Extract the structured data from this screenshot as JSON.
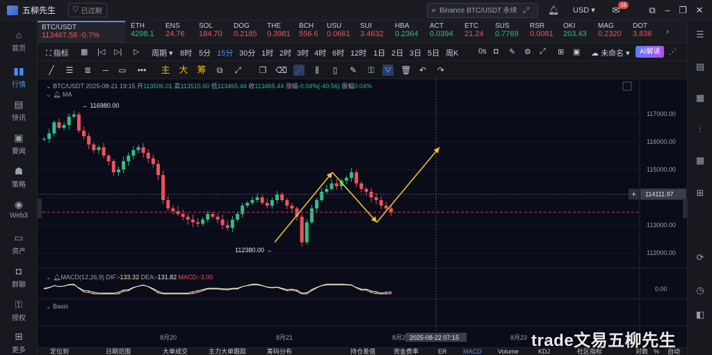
{
  "app": {
    "title": "五柳先生",
    "expired_label": "已过期"
  },
  "search": {
    "placeholder": "Binance BTC/USDT 永续"
  },
  "header": {
    "currency": "USD",
    "message_count": "16"
  },
  "sidebar": {
    "items": [
      {
        "label": "首页",
        "icon": "home-icon"
      },
      {
        "label": "行情",
        "icon": "market-chart-icon"
      },
      {
        "label": "快讯",
        "icon": "news-flash-icon"
      },
      {
        "label": "要闻",
        "icon": "headline-icon"
      },
      {
        "label": "策略",
        "icon": "strategy-icon"
      },
      {
        "label": "Web3",
        "icon": "web3-icon"
      },
      {
        "label": "资产",
        "icon": "wallet-icon"
      },
      {
        "label": "群聊",
        "icon": "group-chat-icon"
      },
      {
        "label": "授权",
        "icon": "authorize-icon"
      },
      {
        "label": "更多",
        "icon": "more-icon"
      }
    ]
  },
  "tickers": [
    {
      "name": "BTC/USDT",
      "price": "113467.58",
      "change": "-0.7%",
      "dir": "down"
    },
    {
      "name": "ETH",
      "price": "4298.1",
      "dir": "up"
    },
    {
      "name": "ENS",
      "price": "24.76",
      "dir": "down"
    },
    {
      "name": "SOL",
      "price": "184.70",
      "dir": "down"
    },
    {
      "name": "DOG",
      "price": "0.2185",
      "dir": "down"
    },
    {
      "name": "THE",
      "price": "0.3981",
      "dir": "down"
    },
    {
      "name": "BCH",
      "price": "556.6",
      "dir": "down"
    },
    {
      "name": "USU",
      "price": "0.0661",
      "dir": "down"
    },
    {
      "name": "SUI",
      "price": "3.4632",
      "dir": "down"
    },
    {
      "name": "HBA",
      "price": "0.2364",
      "dir": "up"
    },
    {
      "name": "ACT",
      "price": "0.0394",
      "dir": "up"
    },
    {
      "name": "ETC",
      "price": "21.24",
      "dir": "down"
    },
    {
      "name": "SUS",
      "price": "0.7769",
      "dir": "up"
    },
    {
      "name": "RSR",
      "price": "0.0081",
      "dir": "down"
    },
    {
      "name": "OKI",
      "price": "203.43",
      "dir": "up"
    },
    {
      "name": "MAG",
      "price": "0.2320",
      "dir": "down"
    },
    {
      "name": "DOT",
      "price": "3.836",
      "dir": "down"
    }
  ],
  "toolbar1": {
    "indicator": "指标",
    "period": "周期",
    "timeframes": [
      "8时",
      "5分",
      "15分",
      "30分",
      "1时",
      "2时",
      "3时",
      "4时",
      "6时",
      "12时",
      "1日",
      "2日",
      "3日",
      "5日",
      "周K"
    ],
    "selected_timeframe": "15分",
    "countdown": "0s",
    "unnamed": "未命名",
    "ai_label": "AI解读"
  },
  "toolbar2": {
    "main": "主",
    "large": "大",
    "chips": "筹"
  },
  "chart": {
    "info": {
      "pair": "BTC/USDT",
      "datetime": "2025-08-21 19:15",
      "open_label": "开",
      "open": "113506.01",
      "high_label": "高",
      "high": "113515.60",
      "low_label": "低",
      "low": "113465.44",
      "close_label": "收",
      "close": "113465.44",
      "change_label": "涨幅",
      "change": "-0.04%(-40.56)",
      "amp_label": "振幅",
      "amp": "0.04%"
    },
    "ma_label": "MA",
    "macd_label": "MACD(12,26,9)",
    "dif_label": "DIF:",
    "dif": "-133.32",
    "dea_label": "DEA:",
    "dea": "-131.82",
    "macd_val_label": "MACD:",
    "macd_val": "-3.00",
    "basis_label": "Basis",
    "crosshair_price": "114111.97",
    "crosshair_time": "2025-08-22 07:15",
    "annotations": {
      "high": "116980.00",
      "low": "112380.00"
    }
  },
  "chart_data": {
    "type": "line",
    "title": "BTC/USDT",
    "y_ticks": [
      117000,
      116000,
      115000,
      114000,
      113000,
      112000
    ],
    "ylim": [
      111500,
      117500
    ],
    "x_ticks": [
      "8月20",
      "8月21",
      "8月2",
      "8月23"
    ],
    "macd_zero": "0.00",
    "series": [
      {
        "name": "BTC/USDT",
        "values": [
          116100,
          116300,
          116700,
          116500,
          116600,
          116900,
          116980,
          116400,
          116200,
          115900,
          115700,
          115800,
          115500,
          115300,
          114900,
          115000,
          115300,
          115500,
          115700,
          115800,
          115600,
          115400,
          115200,
          114800,
          113900,
          113600,
          113500,
          113400,
          113300,
          113200,
          113100,
          113050,
          113200,
          113400,
          113300,
          113200,
          113000,
          112900,
          113200,
          113400,
          113700,
          113800,
          113900,
          114000,
          113800,
          113700,
          113900,
          114100,
          113900,
          113700,
          113600,
          113300,
          112380,
          113100,
          113600,
          113900,
          114200,
          114300,
          114500,
          114400,
          114600,
          114700,
          114900,
          114500,
          114300,
          114200,
          114000,
          113900,
          113700,
          113600,
          113465
        ]
      }
    ],
    "prediction": {
      "points": [
        [
          "8月21 02:00",
          112380
        ],
        [
          "8月21 09:00",
          114900
        ],
        [
          "8月21 13:00",
          113100
        ],
        [
          "8月22 00:00",
          115800
        ]
      ]
    }
  },
  "bottombar": {
    "items": [
      "定位到",
      "日期范围",
      "大单成交",
      "主力大单跟踪",
      "筹码分布",
      "持仓差值",
      "资金费率",
      "ER",
      "MACD",
      "Volume",
      "KDJ",
      "社区指标",
      "对数",
      "%",
      "自动"
    ]
  },
  "watermark": "trade文易五柳先生",
  "colors": {
    "accent": "#4f8df7",
    "up": "#2ebd85",
    "down": "#f0515a",
    "arrow": "#f0c22b",
    "dif": "#f5e08a",
    "dea": "#e8e8e8"
  }
}
